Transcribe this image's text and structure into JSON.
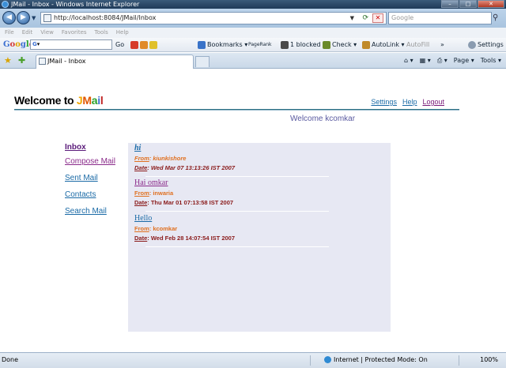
{
  "window": {
    "title": "JMail - Inbox - Windows Internet Explorer",
    "min": "–",
    "max": "□",
    "close": "✕"
  },
  "address": {
    "url": "http://localhost:8084/JMail/Inbox",
    "search_placeholder": "Google"
  },
  "menu": [
    "File",
    "Edit",
    "View",
    "Favorites",
    "Tools",
    "Help"
  ],
  "google_toolbar": {
    "logo": "Google",
    "search_value": "G",
    "go_label": "Go",
    "bookmarks": "Bookmarks",
    "pagerank": "PageRank",
    "blocked": "1 blocked",
    "check": "Check",
    "autolink": "AutoLink",
    "autofill": "AutoFill",
    "more": "»",
    "settings": "Settings"
  },
  "tab": {
    "label": "JMail - Inbox"
  },
  "commands": {
    "page": "Page",
    "tools": "Tools"
  },
  "page": {
    "brand_prefix": "Welcome to ",
    "brand_letters": [
      "J",
      "M",
      "a",
      "i",
      "l"
    ],
    "links": {
      "settings": "Settings",
      "help": "Help",
      "logout": "Logout"
    },
    "welcome": "Welcome kcomkar",
    "nav": {
      "inbox": "Inbox",
      "compose": "Compose Mail",
      "sent": "Sent Mail",
      "contacts": "Contacts",
      "search": "Search Mail"
    },
    "mails": [
      {
        "subject": "hi",
        "from_label": "From",
        "from": ": kiunkishore",
        "date_label": "Date",
        "date": ": Wed Mar 07 13:13:26 IST 2007"
      },
      {
        "subject": "Hai omkar",
        "from_label": "From",
        "from": ": inwaria",
        "date_label": "Date",
        "date": ": Thu Mar 01 07:13:58 IST 2007"
      },
      {
        "subject": "Hello",
        "from_label": "From",
        "from": ": kcomkar",
        "date_label": "Date",
        "date": ": Wed Feb 28 14:07:54 IST 2007"
      }
    ]
  },
  "status": {
    "left": "Done",
    "zone": "Internet | Protected Mode: On",
    "zoom": "100%"
  }
}
